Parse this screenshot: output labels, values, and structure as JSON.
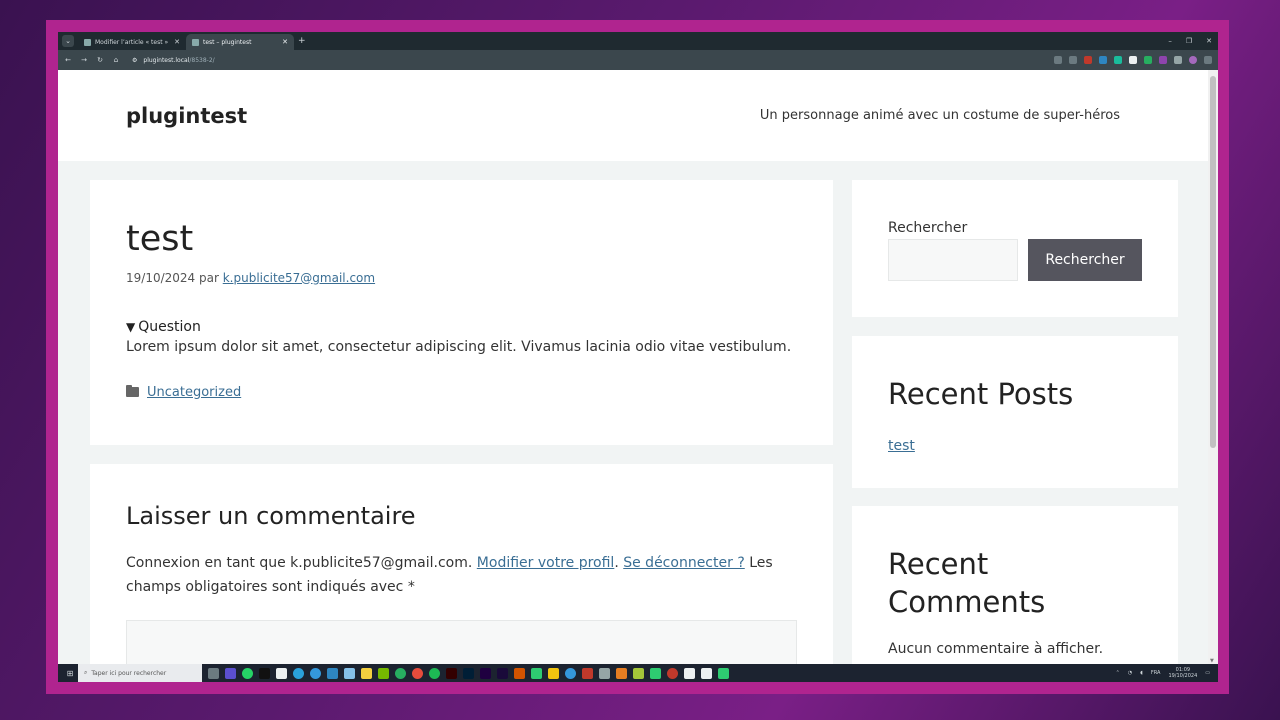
{
  "browser": {
    "tabs": [
      {
        "label": "Modifier l’article « test » ‹ plugintest",
        "active": false
      },
      {
        "label": "test – plugintest",
        "active": true
      }
    ],
    "new_tab": "+",
    "url_host": "plugintest.local",
    "url_path": "/8538-2/",
    "window_controls": [
      "–",
      "❐",
      "✕"
    ]
  },
  "site": {
    "title": "plugintest",
    "tagline": "Un personnage animé avec un costume de super-héros"
  },
  "post": {
    "title": "test",
    "date": "19/10/2024",
    "by": "par",
    "author": "k.publicite57@gmail.com",
    "summary_arrow": "▼",
    "summary": "Question",
    "body": "Lorem ipsum dolor sit amet, consectetur adipiscing elit. Vivamus lacinia odio vitae vestibulum.",
    "category": "Uncategorized"
  },
  "comments": {
    "heading": "Laisser un commentaire",
    "logged_prefix": "Connexion en tant que k.publicite57@gmail.com.",
    "edit_profile": "Modifier votre profil",
    "logout": "Se déconnecter ?",
    "required_note": "Les champs obligatoires sont indiqués avec *"
  },
  "sidebar": {
    "search_label": "Rechercher",
    "search_button": "Rechercher",
    "recent_posts_title": "Recent Posts",
    "recent_post_link": "test",
    "recent_comments_title": "Recent Comments",
    "no_comments": "Aucun commentaire à afficher."
  },
  "taskbar": {
    "search_placeholder": "Taper ici pour rechercher",
    "lang": "FRA",
    "time": "01:09",
    "date": "19/10/2024"
  },
  "colors": {
    "link": "#3a6e94",
    "button": "#55555e",
    "frame": "#b0248f"
  }
}
